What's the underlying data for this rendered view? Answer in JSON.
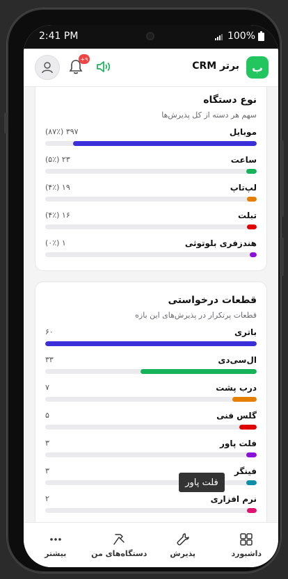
{
  "status_bar": {
    "time": "2:41 PM",
    "battery": "100%"
  },
  "header": {
    "brand_initial": "ب",
    "brand_name": "برتر CRM",
    "notification_count": "+۹"
  },
  "device_type_card": {
    "title": "نوع دستگاه",
    "subtitle": "سهم هر دسته از کل پذیرش‌ها",
    "rows": [
      {
        "label": "موبایل",
        "value": "۳۹۷ (۸۷٪)",
        "share": 0.87,
        "color": "#3b2fd9"
      },
      {
        "label": "ساعت",
        "value": "۲۳ (۵٪)",
        "share": 0.05,
        "color": "#16b35a"
      },
      {
        "label": "لپ‌تاپ",
        "value": "۱۹ (۴٪)",
        "share": 0.04,
        "color": "#e67e00"
      },
      {
        "label": "تبلت",
        "value": "۱۶ (۴٪)",
        "share": 0.04,
        "color": "#e00000"
      },
      {
        "label": "هندزفری بلوتوثی",
        "value": "۱ (۰٪)",
        "share": 0.0,
        "color": "#8b10d9"
      }
    ]
  },
  "parts_card": {
    "title": "قطعات درخواستی",
    "subtitle": "قطعات پرتکرار در پذیرش‌های این بازه",
    "rows": [
      {
        "label": "باتری",
        "value": "۶۰",
        "count": 60,
        "color": "#3b2fd9"
      },
      {
        "label": "ال‌سی‌دی",
        "value": "۳۳",
        "count": 33,
        "color": "#16b35a"
      },
      {
        "label": "درب پشت",
        "value": "۷",
        "count": 7,
        "color": "#e67e00"
      },
      {
        "label": "گلس فنی",
        "value": "۵",
        "count": 5,
        "color": "#e00000"
      },
      {
        "label": "فلت پاور",
        "value": "۳",
        "count": 3,
        "color": "#8b10d9"
      },
      {
        "label": "فینگر",
        "value": "۳",
        "count": 3,
        "color": "#0e8fa8"
      },
      {
        "label": "نرم افزاری",
        "value": "۲",
        "count": 2,
        "color": "#e0136e"
      }
    ]
  },
  "tooltip": {
    "text": "فلت پاور"
  },
  "nav": {
    "dashboard": "داشبورد",
    "reception": "پذیرش",
    "my_devices": "دستگاه‌های من",
    "more": "بیشتر"
  }
}
